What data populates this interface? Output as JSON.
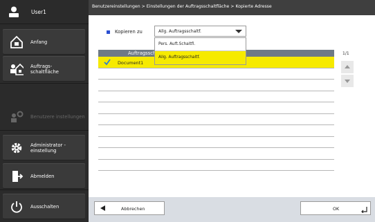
{
  "user": {
    "name": "User1"
  },
  "sidebar": {
    "items": [
      {
        "label": "Anfang",
        "enabled": true
      },
      {
        "label": "Auftrags-\nschaltfläche",
        "enabled": true
      },
      {
        "label": "Benutzere instellungen",
        "enabled": false
      },
      {
        "label": "Administrator -\neinstellung",
        "enabled": true
      },
      {
        "label": "Abmelden",
        "enabled": true
      },
      {
        "label": "Ausschalten",
        "enabled": true
      }
    ]
  },
  "breadcrumb": "Benutzereinstellungen > Einstellungen der Auftragsschaltfläche > Kopierte Adresse",
  "copy_to": {
    "label": "Kopieren zu",
    "selected": "Allg. Auftragsschaltf.",
    "options": [
      "Pers. Auft.Schaltfl.",
      "Allg. Auftragsschaltf."
    ]
  },
  "table": {
    "header": "Auftragsschalt",
    "rows": [
      "Document1",
      "",
      "",
      "",
      "",
      "",
      "",
      "",
      "",
      ""
    ]
  },
  "pager": {
    "text": "1/1"
  },
  "footer": {
    "cancel_label": "Abbrechen",
    "ok_label": "OK"
  },
  "colors": {
    "accent_yellow": "#f6ea00",
    "sidebar_bg": "#2b2b2b",
    "breadcrumb_bg": "#3f3f3f",
    "marker_blue": "#2a4fd1"
  }
}
